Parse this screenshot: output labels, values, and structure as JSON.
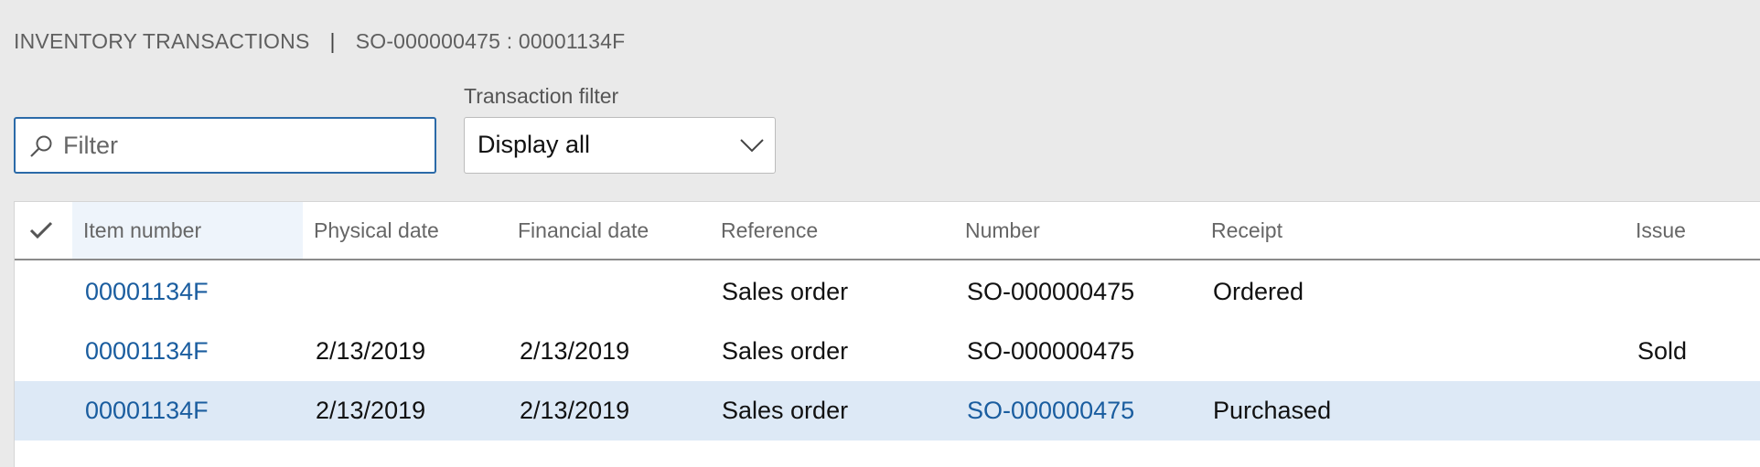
{
  "breadcrumb": {
    "section": "INVENTORY TRANSACTIONS",
    "separator": "|",
    "record": "SO-000000475 : 00001134F"
  },
  "filter": {
    "placeholder": "Filter",
    "value": ""
  },
  "transaction_filter": {
    "label": "Transaction filter",
    "value": "Display all"
  },
  "grid": {
    "columns": [
      "Item number",
      "Physical date",
      "Financial date",
      "Reference",
      "Number",
      "Receipt",
      "Issue"
    ],
    "rows": [
      {
        "item": "00001134F",
        "physical": "",
        "financial": "",
        "reference": "Sales order",
        "number": "SO-000000475",
        "receipt": "Ordered",
        "issue": ""
      },
      {
        "item": "00001134F",
        "physical": "2/13/2019",
        "financial": "2/13/2019",
        "reference": "Sales order",
        "number": "SO-000000475",
        "receipt": "",
        "issue": "Sold"
      },
      {
        "item": "00001134F",
        "physical": "2/13/2019",
        "financial": "2/13/2019",
        "reference": "Sales order",
        "number": "SO-000000475",
        "receipt": "Purchased",
        "issue": ""
      }
    ],
    "selected_row": 2
  },
  "colors": {
    "background": "#eaeaea",
    "link": "#1a5d9f",
    "selected_row": "#dde9f6",
    "focus_border": "#2b6aa8"
  },
  "icons": {
    "search": "search-icon",
    "dropdown": "chevron-down-icon",
    "select_all": "checkmark-icon"
  }
}
